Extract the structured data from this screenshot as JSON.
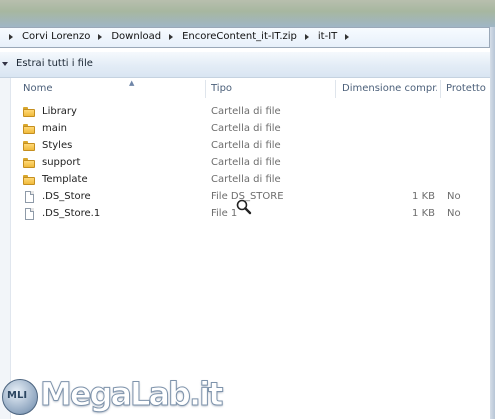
{
  "address_bar": {
    "crumbs": [
      "Corvi Lorenzo",
      "Download",
      "EncoreContent_it-IT.zip",
      "it-IT"
    ]
  },
  "toolbar": {
    "extract_label": "Estrai tutti i file"
  },
  "columns": {
    "name": "Nome",
    "type": "Tipo",
    "size": "Dimensione compr...",
    "protected": "Protetto d"
  },
  "files": [
    {
      "name": "Library",
      "type": "Cartella di file",
      "size": "",
      "protected": "",
      "icon": "folder-icon"
    },
    {
      "name": "main",
      "type": "Cartella di file",
      "size": "",
      "protected": "",
      "icon": "folder-icon"
    },
    {
      "name": "Styles",
      "type": "Cartella di file",
      "size": "",
      "protected": "",
      "icon": "folder-icon"
    },
    {
      "name": "support",
      "type": "Cartella di file",
      "size": "",
      "protected": "",
      "icon": "folder-icon"
    },
    {
      "name": "Template",
      "type": "Cartella di file",
      "size": "",
      "protected": "",
      "icon": "folder-icon"
    },
    {
      "name": ".DS_Store",
      "type": "File DS_STORE",
      "size": "1 KB",
      "protected": "No",
      "icon": "file-icon"
    },
    {
      "name": ".DS_Store.1",
      "type": "File 1",
      "size": "1 KB",
      "protected": "No",
      "icon": "file-icon"
    }
  ],
  "watermark": {
    "badge": "MLI",
    "text": "MegaLab.it"
  },
  "colors": {
    "header_text": "#4c607a",
    "folder": "#f0bb3c",
    "toolbar_bg": "#e3ecf6"
  }
}
